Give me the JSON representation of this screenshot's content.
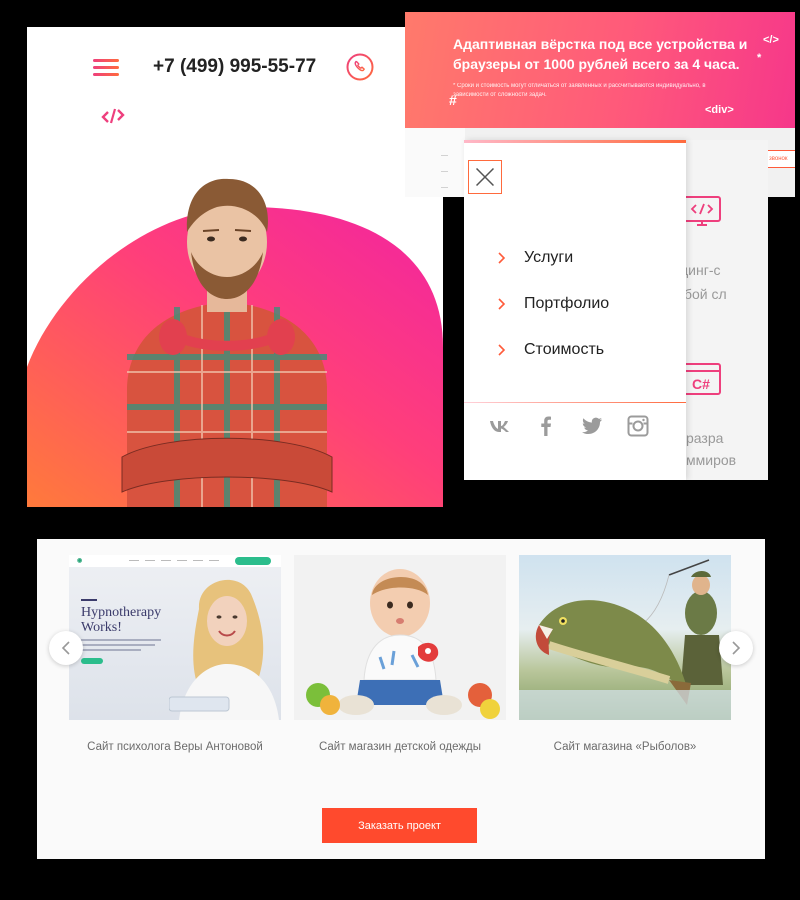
{
  "hero": {
    "phone": "+7 (499) 995-55-77",
    "icons": {
      "menu": "hamburger-icon",
      "call": "phone-icon",
      "code": "code-brackets-icon"
    },
    "colors": {
      "accent_pink": "#ee3f7d",
      "accent_orange": "#ff6a3d"
    }
  },
  "banner": {
    "title": "Адаптивная вёрстка под все устройства и браузеры от 1000 рублей всего за 4 часа.",
    "note": "* Сроки и стоимость могут отличаться от заявленных и рассчитываются индивидуально, в зависимости от сложности задач.",
    "deco_div": "<div>",
    "deco_hash": "#",
    "deco_code": "</>",
    "deco_star": "*",
    "order_small": "Заказать звонок",
    "social_mini": [
      "f",
      "t",
      "i"
    ]
  },
  "menu": {
    "items": [
      {
        "label": "Услуги"
      },
      {
        "label": "Портфолио"
      },
      {
        "label": "Стоимость"
      }
    ],
    "socials": [
      "vk-icon",
      "facebook-icon",
      "twitter-icon",
      "instagram-icon"
    ],
    "bg_text": {
      "line1": "динг-с",
      "line2": "бой сл",
      "line3": "разра",
      "line4": "ммиров"
    }
  },
  "portfolio": {
    "slides": [
      {
        "caption": "Сайт психолога Веры Антоновой",
        "thumb_heading_1": "Hypnotherapy",
        "thumb_heading_2": "Works!"
      },
      {
        "caption": "Сайт магазин детской одежды"
      },
      {
        "caption": "Сайт магазина «Рыболов»"
      }
    ],
    "order_button": "Заказать проект",
    "colors": {
      "button": "#ff4a2d"
    }
  }
}
